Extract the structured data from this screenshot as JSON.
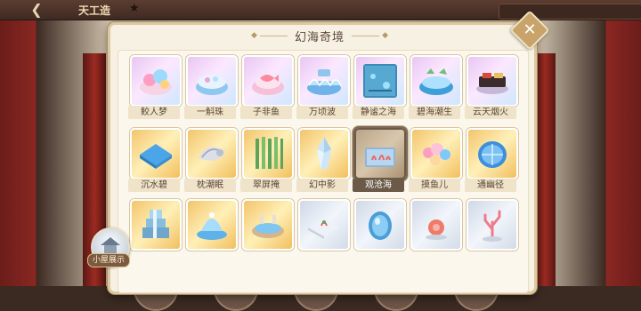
{
  "header": {
    "title": "天工造",
    "back_icon": "back-arrow-icon",
    "star_icon": "star-icon"
  },
  "house_button": {
    "label": "小屋展示"
  },
  "modal": {
    "title": "幻海奇境",
    "close_icon": "close-icon",
    "items": [
      {
        "name": "鲛人梦",
        "style": "purple",
        "icon": "shell-garden-icon"
      },
      {
        "name": "一斛珠",
        "style": "purple",
        "icon": "pearl-platform-icon"
      },
      {
        "name": "子非鱼",
        "style": "purple",
        "icon": "fish-pond-icon"
      },
      {
        "name": "万顷波",
        "style": "purple",
        "icon": "wave-platform-icon"
      },
      {
        "name": "静谧之海",
        "style": "purple",
        "icon": "sea-floor-icon"
      },
      {
        "name": "碧海潮生",
        "style": "purple",
        "icon": "tide-pool-icon"
      },
      {
        "name": "云天烟火",
        "style": "purple",
        "icon": "firework-boat-icon"
      },
      {
        "name": "沉水碧",
        "style": "gold",
        "icon": "water-tile-icon"
      },
      {
        "name": "枕潮眠",
        "style": "gold",
        "icon": "conch-shell-icon"
      },
      {
        "name": "翠屏掩",
        "style": "gold",
        "icon": "seaweed-screen-icon"
      },
      {
        "name": "幻中影",
        "style": "gold",
        "icon": "crystal-icon"
      },
      {
        "name": "观沧海",
        "style": "selected",
        "icon": "coral-tank-icon"
      },
      {
        "name": "摸鱼儿",
        "style": "gold",
        "icon": "coral-reef-icon"
      },
      {
        "name": "通幽径",
        "style": "gold",
        "icon": "glass-dome-icon"
      },
      {
        "name": "",
        "style": "gold",
        "icon": "waterfall-steps-icon"
      },
      {
        "name": "",
        "style": "gold",
        "icon": "shell-fountain-icon"
      },
      {
        "name": "",
        "style": "gold",
        "icon": "bathing-pool-icon"
      },
      {
        "name": "",
        "style": "blue",
        "icon": "coral-tile-icon"
      },
      {
        "name": "",
        "style": "blue",
        "icon": "blue-egg-icon"
      },
      {
        "name": "",
        "style": "blue",
        "icon": "sea-urchin-icon"
      },
      {
        "name": "",
        "style": "blue",
        "icon": "coral-branch-icon"
      }
    ]
  }
}
